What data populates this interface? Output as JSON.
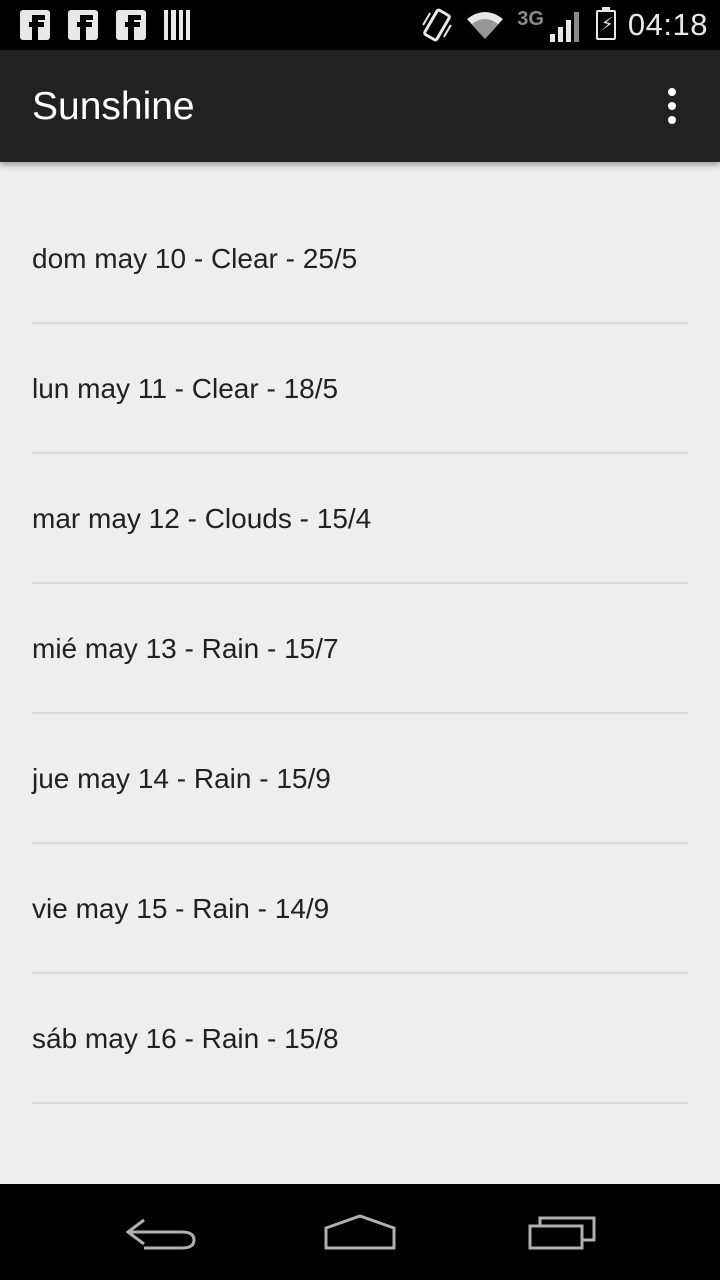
{
  "status_bar": {
    "time": "04:18",
    "network": "3G",
    "icons": [
      "facebook-icon",
      "facebook-icon",
      "facebook-icon",
      "barcode-icon",
      "vibrate-icon",
      "wifi-icon",
      "signal-icon",
      "battery-charging-icon"
    ]
  },
  "app_bar": {
    "title": "Sunshine",
    "menu_icon": "overflow-menu-icon"
  },
  "forecast": [
    {
      "text": "dom may 10 - Clear - 25/5"
    },
    {
      "text": "lun may 11 - Clear - 18/5"
    },
    {
      "text": "mar may 12 - Clouds - 15/4"
    },
    {
      "text": "mié may 13 - Rain - 15/7"
    },
    {
      "text": "jue may 14 - Rain - 15/9"
    },
    {
      "text": "vie may 15 - Rain - 14/9"
    },
    {
      "text": "sáb may 16 - Rain - 15/8"
    }
  ],
  "nav_bar": {
    "icons": [
      "back-icon",
      "home-icon",
      "recents-icon"
    ]
  },
  "colors": {
    "status_bar": "#000000",
    "action_bar": "#212121",
    "background": "#eeeeee",
    "divider": "#d9d9d9",
    "text": "#212121"
  }
}
